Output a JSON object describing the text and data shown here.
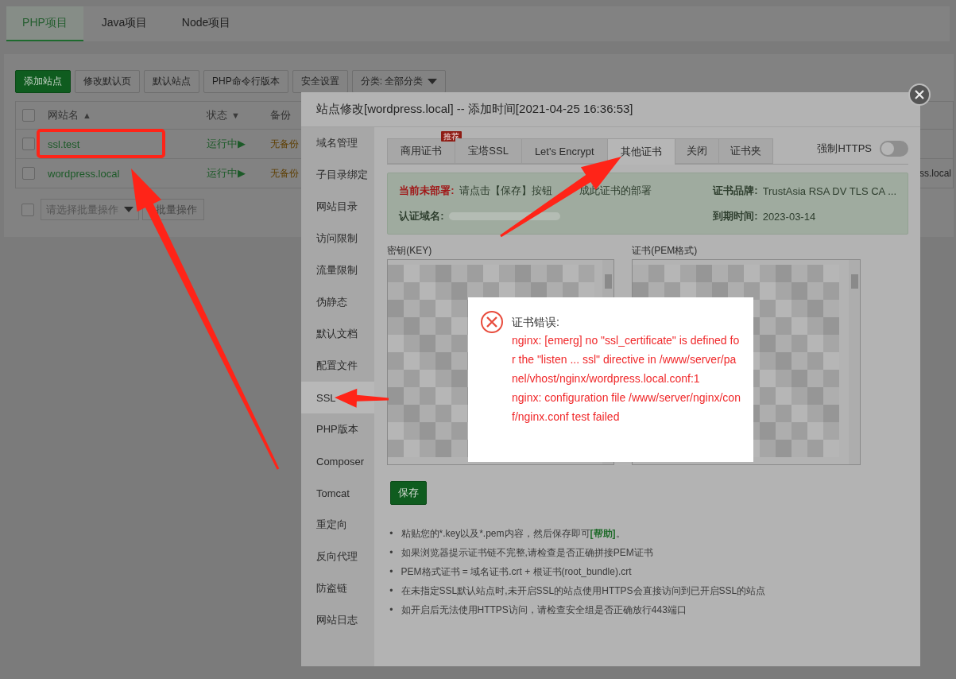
{
  "project_tabs": [
    {
      "label": "PHP项目",
      "selected": true
    },
    {
      "label": "Java项目",
      "selected": false
    },
    {
      "label": "Node项目",
      "selected": false
    }
  ],
  "toolbar": [
    {
      "label": "添加站点",
      "kind": "primary"
    },
    {
      "label": "修改默认页",
      "kind": "default"
    },
    {
      "label": "默认站点",
      "kind": "default"
    },
    {
      "label": "PHP命令行版本",
      "kind": "default"
    },
    {
      "label": "安全设置",
      "kind": "default"
    },
    {
      "label": "分类: 全部分类",
      "kind": "dropdown"
    }
  ],
  "site_table": {
    "header_checked": false,
    "columns": [
      {
        "label": "网站名",
        "sort_mark": "▲"
      },
      {
        "label": "状态",
        "sort_mark": "▼"
      },
      {
        "label": "备份"
      }
    ],
    "rows": [
      {
        "checked": false,
        "name": "ssl.test",
        "status": "运行中▶",
        "backup": "无备份"
      },
      {
        "checked": false,
        "name": "wordpress.local",
        "status": "运行中▶",
        "backup": "无备份",
        "column_right": "ss.local"
      }
    ]
  },
  "batch": {
    "checked": false,
    "placeholder": "请选择批量操作",
    "button": "批量操作"
  },
  "dialog": {
    "title": "站点修改[wordpress.local] -- 添加时间[2021-04-25 16:36:53]",
    "menu": [
      {
        "label": "域名管理",
        "selected": false
      },
      {
        "label": "子目录绑定",
        "selected": false
      },
      {
        "label": "网站目录",
        "selected": false
      },
      {
        "label": "访问限制",
        "selected": false
      },
      {
        "label": "流量限制",
        "selected": false
      },
      {
        "label": "伪静态",
        "selected": false
      },
      {
        "label": "默认文档",
        "selected": false
      },
      {
        "label": "配置文件",
        "selected": false
      },
      {
        "label": "SSL",
        "selected": true
      },
      {
        "label": "PHP版本",
        "selected": false
      },
      {
        "label": "Composer",
        "selected": false
      },
      {
        "label": "Tomcat",
        "selected": false
      },
      {
        "label": "重定向",
        "selected": false
      },
      {
        "label": "反向代理",
        "selected": false
      },
      {
        "label": "防盗链",
        "selected": false
      },
      {
        "label": "网站日志",
        "selected": false
      }
    ],
    "ssl_tabs": [
      {
        "label": "商用证书",
        "selected": false,
        "badge": "推荐"
      },
      {
        "label": "宝塔SSL",
        "selected": false
      },
      {
        "label": "Let's Encrypt",
        "selected": false
      },
      {
        "label": "其他证书",
        "selected": true
      },
      {
        "label": "关闭",
        "selected": false
      },
      {
        "label": "证书夹",
        "selected": false
      }
    ],
    "force_https": {
      "label": "强制HTTPS",
      "on": false
    },
    "cert_info": {
      "status_label": "当前未部署:",
      "status_text": [
        "请点击【保存】按钮",
        "成此证书的部署"
      ],
      "domain_label": "认证域名:",
      "brand_label": "证书品牌:",
      "brand": "TrustAsia RSA DV TLS CA ...",
      "expiry_label": "到期时间:",
      "expiry": "2023-03-14"
    },
    "key_label": "密钥(KEY)",
    "cert_label": "证书(PEM格式)",
    "save_button": "保存",
    "tips": [
      {
        "bullet": "•",
        "text": "粘贴您的*.key以及*.pem内容，然后保存即可",
        "link": "[帮助]",
        "after": "。"
      },
      {
        "bullet": "•",
        "text": "如果浏览器提示证书链不完整,请检查是否正确拼接PEM证书"
      },
      {
        "bullet": "•",
        "text": "PEM格式证书 = 域名证书.crt + 根证书(root_bundle).crt"
      },
      {
        "bullet": "•",
        "text": "在未指定SSL默认站点时,未开启SSL的站点使用HTTPS会直接访问到已开启SSL的站点"
      },
      {
        "bullet": "•",
        "text": "如开启后无法使用HTTPS访问，请检查安全组是否正确放行443端口"
      }
    ]
  },
  "error_popup": {
    "title": "证书错误:",
    "messages": [
      "nginx: [emerg] no \"ssl_certificate\" is defined for the \"listen ... ssl\" directive in /www/server/panel/vhost/nginx/wordpress.local.conf:1",
      "nginx: configuration file /www/server/nginx/conf/nginx.conf test failed"
    ]
  }
}
